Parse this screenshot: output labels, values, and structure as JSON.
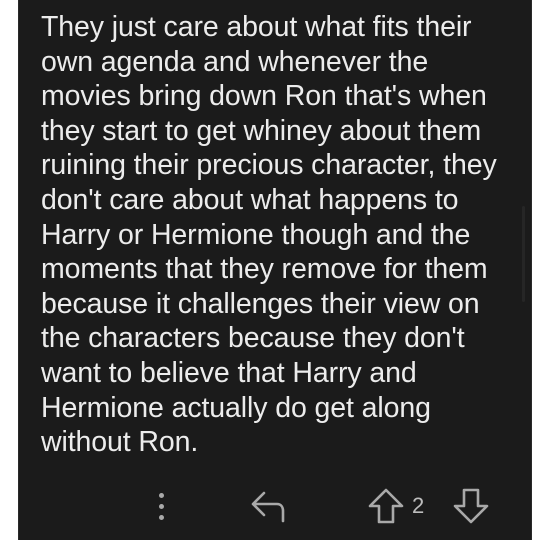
{
  "comment": {
    "text": "They just care about what fits their own agenda and whenever the movies bring down Ron that's when they start to get whiney about them ruining their precious character, they don't care about what happens to Harry or Hermione though and the moments that they remove for them because it challenges their view on the characters because they don't want to believe that Harry and Hermione actually do get along without Ron."
  },
  "actions": {
    "more_icon": "more-vertical-icon",
    "reply_icon": "reply-arrow-icon",
    "upvote_icon": "upvote-arrow-icon",
    "score": "2",
    "downvote_icon": "downvote-arrow-icon"
  },
  "colors": {
    "background": "#1b1b1b",
    "text": "#ececec",
    "icon": "#a9a9a9"
  }
}
